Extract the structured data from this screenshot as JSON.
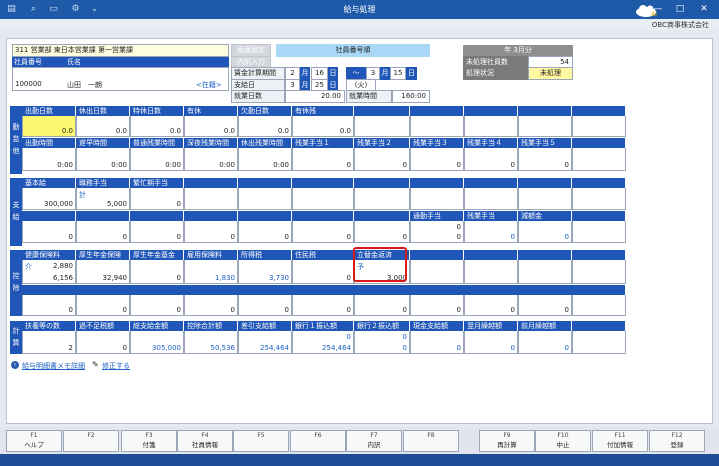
{
  "app": {
    "title": "給与処理",
    "company": "OBC商事株式会社"
  },
  "employee": {
    "dept": "311 営業部 東日本営業課 第一営業課",
    "code_label": "社員番号",
    "name_label": "氏名",
    "code": "100000",
    "name": "山田　一朗",
    "status": "<在籍>"
  },
  "header_mid": {
    "btn_search": "画面設定",
    "btn_input": "内訳入力",
    "sort_label": "社員番号順",
    "period_label": "賃金計算期間",
    "period_from_m": "2",
    "period_from_d": "16",
    "tilde": "〜",
    "period_to_m": "3",
    "period_to_d": "15",
    "unit_m": "月",
    "unit_d": "日",
    "pay_label": "支給日",
    "pay_m": "3",
    "pay_d": "25",
    "pay_dow": "(火)",
    "workdays_label": "就業日数",
    "workdays": "20.00",
    "workhours_label": "就業時間",
    "workhours": "160:00"
  },
  "header_right": {
    "month": "年 3月分",
    "unproc_label": "未処理社員数",
    "unproc": "54",
    "state_label": "処理状況",
    "state": "未処理"
  },
  "attendance": {
    "side": [
      "勤",
      "怠",
      "他"
    ],
    "row1_headers": [
      "出勤日数",
      "休出日数",
      "特休日数",
      "有休",
      "欠勤日数",
      "有休残",
      "",
      "",
      "",
      "",
      ""
    ],
    "row1_values": [
      "0.0",
      "0.0",
      "0.0",
      "0.0",
      "0.0",
      "0.0",
      "",
      "",
      "",
      "",
      ""
    ],
    "row2_headers": [
      "出勤時間",
      "遅早時間",
      "普通残業時間",
      "深夜残業時間",
      "休出残業時間",
      "残業手当１",
      "残業手当２",
      "残業手当３",
      "残業手当４",
      "残業手当５",
      ""
    ],
    "row2_values": [
      "0:00",
      "0:00",
      "0:00",
      "0:00",
      "0:00",
      "0",
      "0",
      "0",
      "0",
      "0",
      ""
    ]
  },
  "payments": {
    "side": [
      "支",
      "給"
    ],
    "row1_headers": [
      "基本給",
      "職務手当",
      "繁忙期手当",
      "",
      "",
      "",
      "",
      "",
      "",
      "",
      ""
    ],
    "row1_sub": [
      "",
      "計",
      "",
      "",
      "",
      "",
      "",
      "",
      "",
      "",
      ""
    ],
    "row1_values": [
      "300,000",
      "5,000",
      "0",
      "",
      "",
      "",
      "",
      "",
      "",
      "",
      ""
    ],
    "row2_headers": [
      "",
      "",
      "",
      "",
      "",
      "",
      "",
      "通勤手当",
      "残業手当",
      "減額金",
      ""
    ],
    "row2_sub": [
      "",
      "",
      "",
      "",
      "",
      "",
      "",
      "0",
      "",
      "",
      ""
    ],
    "row2_values": [
      "0",
      "0",
      "0",
      "0",
      "0",
      "0",
      "0",
      "0",
      "0",
      "0",
      ""
    ]
  },
  "deductions": {
    "side": [
      "控",
      "除"
    ],
    "row1_headers": [
      "健康保険料",
      "厚生年金保険",
      "厚生年金基金",
      "雇用保険料",
      "所得税",
      "住民税",
      "立替金返済",
      "",
      "",
      "",
      ""
    ],
    "row1_sub": [
      "介",
      "",
      "",
      "",
      "",
      "",
      "予",
      "",
      "",
      "",
      ""
    ],
    "row1_sub_values": [
      "2,880",
      "",
      "",
      "",
      "",
      "",
      "",
      "",
      "",
      "",
      ""
    ],
    "row1_values": [
      "6,156",
      "32,940",
      "0",
      "1,830",
      "3,730",
      "0",
      "3,000",
      "",
      "",
      "",
      ""
    ],
    "row2_values": [
      "0",
      "0",
      "0",
      "0",
      "0",
      "0",
      "0",
      "0",
      "0",
      "0",
      ""
    ]
  },
  "totals": {
    "side": [
      "計",
      "算"
    ],
    "headers": [
      "扶養等の数",
      "過不足税額",
      "総支給金額",
      "控除合計額",
      "差引支給額",
      "銀行１振込額",
      "銀行２振込額",
      "現金支給額",
      "翌月繰越額",
      "前月繰越額",
      ""
    ],
    "top_values": [
      "",
      "",
      "",
      "",
      "",
      "0",
      "0",
      "",
      "",
      "",
      ""
    ],
    "values": [
      "2",
      "0",
      "305,000",
      "50,536",
      "254,464",
      "254,464",
      "0",
      "0",
      "0",
      "0",
      ""
    ]
  },
  "links": {
    "memo": "給与明細書メモ詳細",
    "edit": "修正する"
  },
  "fkeys": [
    {
      "fn": "F1",
      "label": "ヘルプ"
    },
    {
      "fn": "F2",
      "label": ""
    },
    {
      "fn": "F3",
      "label": "付箋"
    },
    {
      "fn": "F4",
      "label": "社員情報"
    },
    {
      "fn": "F5",
      "label": ""
    },
    {
      "fn": "F6",
      "label": ""
    },
    {
      "fn": "F7",
      "label": "内訳"
    },
    {
      "fn": "F8",
      "label": ""
    },
    {
      "fn": "F9",
      "label": "再計算"
    },
    {
      "fn": "F10",
      "label": "中止"
    },
    {
      "fn": "F11",
      "label": "付加情報"
    },
    {
      "fn": "F12",
      "label": "登録"
    }
  ]
}
